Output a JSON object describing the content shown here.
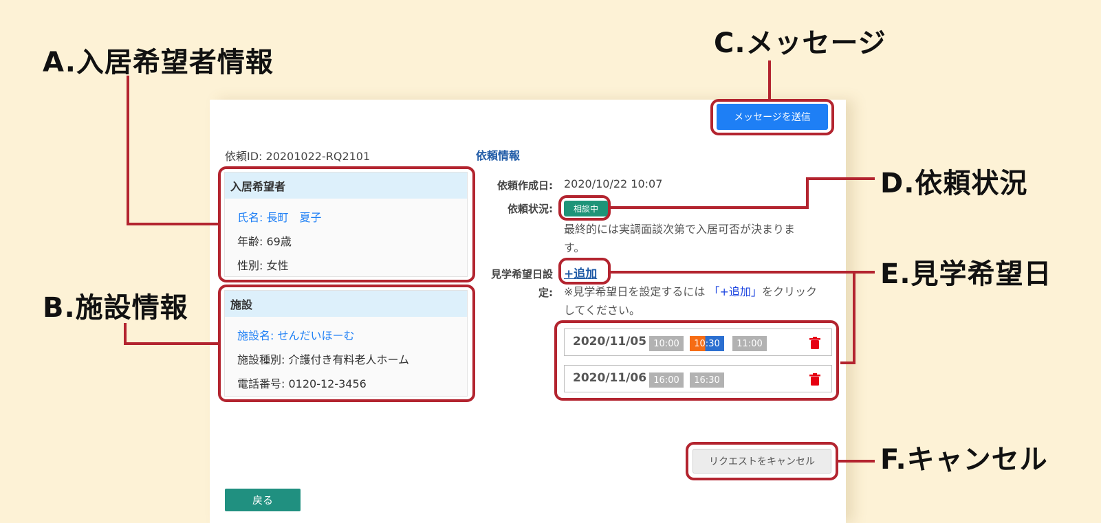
{
  "callouts": {
    "a": "A.入居希望者情報",
    "b": "B.施設情報",
    "c": "C.メッセージ",
    "d": "D.依頼状況",
    "e": "E.見学希望日",
    "f": "F.キャンセル"
  },
  "header": {
    "send_message_label": "メッセージを送信",
    "request_id": "依頼ID: 20201022-RQ2101"
  },
  "applicant": {
    "title": "入居希望者",
    "name": "氏名: 長町　夏子",
    "age": "年齢: 69歳",
    "gender": "性別: 女性"
  },
  "facility": {
    "title": "施設",
    "name": "施設名: せんだいほーむ",
    "type": "施設種別: 介護付き有料老人ホーム",
    "phone": "電話番号: 0120-12-3456"
  },
  "request_info": {
    "title": "依頼情報",
    "created_label": "依頼作成日:",
    "created_value": "2020/10/22 10:07",
    "status_label": "依頼状況:",
    "status_badge": "相談中",
    "status_note_line1": "最終的には実調面談次第で入居可否が決まりま",
    "status_note_line2": "す。",
    "visit_label_line1": "見学希望日設",
    "visit_label_line2": "定:",
    "add_label": "+追加",
    "visit_note_prefix": "※見学希望日を設定するには",
    "visit_note_link": "「+追加」",
    "visit_note_suffix": "をクリック",
    "visit_note_line2": "してください。"
  },
  "visit_dates": [
    {
      "date": "2020/11/05",
      "slots": [
        "10:00",
        "10:30",
        "11:00"
      ]
    },
    {
      "date": "2020/11/06",
      "slots": [
        "16:00",
        "16:30"
      ]
    }
  ],
  "footer": {
    "cancel_label": "リクエストをキャンセル",
    "back_label": "戻る"
  },
  "colors": {
    "highlight": "#b3242f",
    "primary": "#1e7ff5",
    "status": "#1e9478",
    "selected_slot_start": "#f66c14",
    "selected_slot_end": "#2b6fd0"
  }
}
